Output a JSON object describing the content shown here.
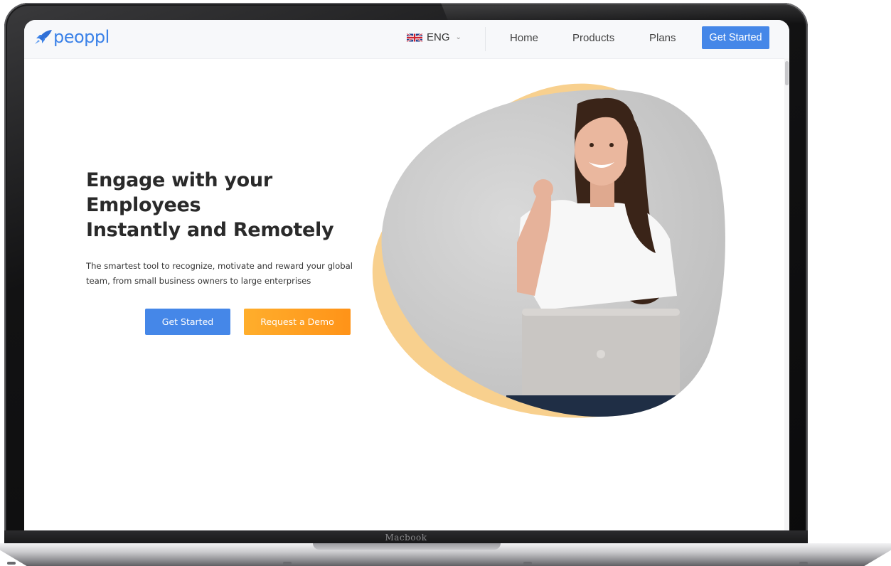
{
  "device": {
    "label": "Macbook"
  },
  "nav": {
    "brand": "peoppl",
    "language": "ENG",
    "links": [
      "Home",
      "Products",
      "Plans"
    ],
    "cta": "Get Started"
  },
  "hero": {
    "title_lines": [
      "Engage with your",
      "Employees",
      "Instantly and Remotely"
    ],
    "subtitle": "The smartest tool to recognize, motivate and reward your global team, from small business owners to large enterprises",
    "primary_button": "Get Started",
    "secondary_button": "Request a Demo"
  },
  "colors": {
    "brand_blue": "#4587e8",
    "demo_orange": "#ff9f22",
    "blob_yellow": "#f8d08e",
    "photo_wall": "#cdcdcd"
  },
  "icons": [
    "rocket-icon",
    "uk-flag-icon",
    "chevron-down-icon"
  ]
}
